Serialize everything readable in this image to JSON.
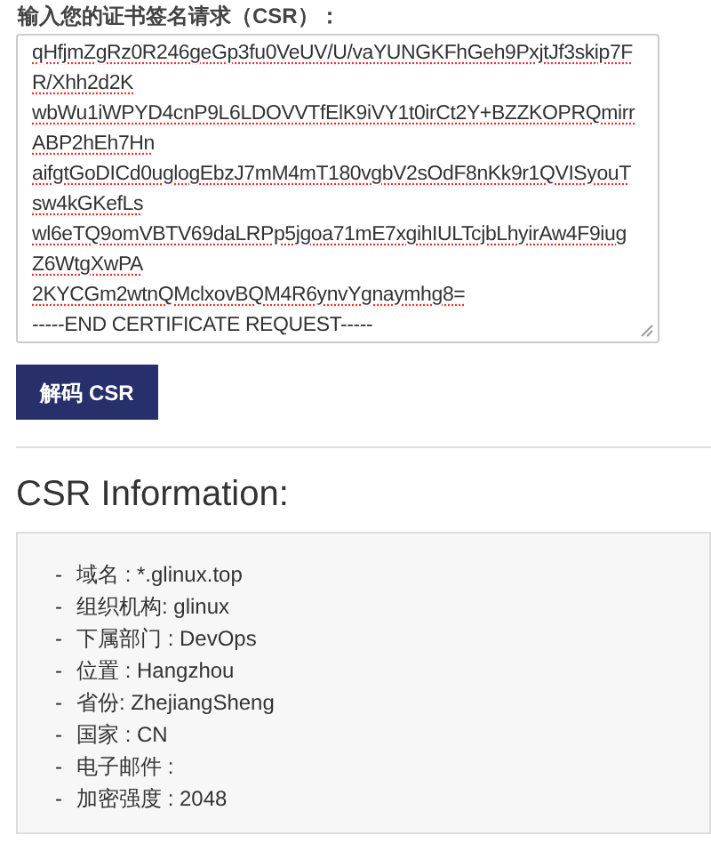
{
  "csr_field": {
    "label": "输入您的证书签名请求（CSR）：",
    "lines": [
      {
        "text": "qHfjmZgRz0R246geGp3fu0VeUV/U/vaYUNGKFhGeh9PxjtJf3skip7F",
        "flagged": true
      },
      {
        "text": "R/Xhh2d2K",
        "flagged": true
      },
      {
        "text": "wbWu1iWPYD4cnP9L6LDOVVTfElK9iVY1t0irCt2Y+BZZKOPRQmirr",
        "flagged": true
      },
      {
        "text": "ABP2hEh7Hn",
        "flagged": true
      },
      {
        "text": "aifgtGoDICd0uglogEbzJ7mM4mT180vgbV2sOdF8nKk9r1QVISyouT",
        "flagged": true
      },
      {
        "text": "sw4kGKefLs",
        "flagged": true
      },
      {
        "text": "wl6eTQ9omVBTV69daLRPp5jgoa71mE7xgihIULTcjbLhyirAw4F9iug",
        "flagged": true
      },
      {
        "text": "Z6WtgXwPA",
        "flagged": true
      },
      {
        "text": "2KYCGm2wtnQMclxovBQM4R6ynvYgnaymhg8=",
        "flagged": true
      },
      {
        "text": "-----END CERTIFICATE REQUEST-----",
        "flagged": false
      }
    ]
  },
  "decode_button": "解码 CSR",
  "info": {
    "title": "CSR Information:",
    "items": [
      {
        "marker": "-",
        "text": "域名 : *.glinux.top"
      },
      {
        "marker": "-",
        "text": "组织机构: glinux"
      },
      {
        "marker": "-",
        "text": "下属部门 : DevOps"
      },
      {
        "marker": "-",
        "text": "位置 : Hangzhou"
      },
      {
        "marker": "-",
        "text": "省份: ZhejiangSheng"
      },
      {
        "marker": "-",
        "text": "国家 : CN"
      },
      {
        "marker": "-",
        "text": "电子邮件 :"
      },
      {
        "marker": "-",
        "text": "加密强度 : 2048"
      }
    ]
  }
}
